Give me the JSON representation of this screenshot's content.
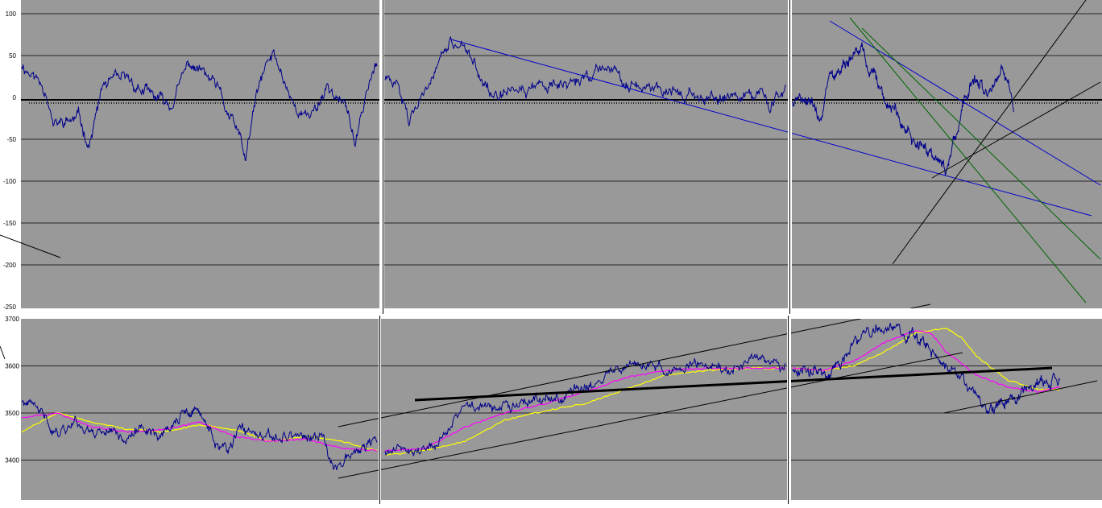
{
  "window": {
    "background": "#ffffff",
    "plot_background": "#999999",
    "divider_color": "#ffffff",
    "series_color": "#00008b",
    "gridline_color": "#000000"
  },
  "chart_data": [
    {
      "id": "oscillator",
      "type": "line",
      "title": "",
      "xlabel": "",
      "ylabel": "",
      "ylim": [
        -250,
        115
      ],
      "yticks": [
        100,
        50,
        0,
        -50,
        -100,
        -150,
        -200,
        -250
      ],
      "grid": true,
      "panels": [
        {
          "id": "osc-left",
          "anchors": [
            [
              0,
              40
            ],
            [
              0.07,
              10
            ],
            [
              0.09,
              -35
            ],
            [
              0.16,
              -25
            ],
            [
              0.19,
              -55
            ],
            [
              0.23,
              15
            ],
            [
              0.3,
              20
            ],
            [
              0.37,
              0
            ],
            [
              0.42,
              -10
            ],
            [
              0.47,
              40
            ],
            [
              0.51,
              30
            ],
            [
              0.55,
              10
            ],
            [
              0.58,
              -20
            ],
            [
              0.61,
              -45
            ],
            [
              0.63,
              -75
            ],
            [
              0.66,
              0
            ],
            [
              0.69,
              40
            ],
            [
              0.71,
              50
            ],
            [
              0.74,
              20
            ],
            [
              0.77,
              -10
            ],
            [
              0.8,
              -25
            ],
            [
              0.83,
              -10
            ],
            [
              0.86,
              15
            ],
            [
              0.89,
              0
            ],
            [
              0.92,
              -20
            ],
            [
              0.94,
              -60
            ],
            [
              0.97,
              10
            ],
            [
              1,
              40
            ]
          ]
        },
        {
          "id": "osc-middle",
          "anchors": [
            [
              0,
              25
            ],
            [
              0.04,
              5
            ],
            [
              0.06,
              -25
            ],
            [
              0.09,
              10
            ],
            [
              0.12,
              20
            ],
            [
              0.15,
              55
            ],
            [
              0.17,
              65
            ],
            [
              0.21,
              50
            ],
            [
              0.25,
              25
            ],
            [
              0.28,
              -5
            ],
            [
              0.31,
              0
            ],
            [
              0.38,
              15
            ],
            [
              0.44,
              10
            ],
            [
              0.48,
              20
            ],
            [
              0.52,
              30
            ],
            [
              0.56,
              40
            ],
            [
              0.6,
              20
            ],
            [
              0.65,
              15
            ],
            [
              0.7,
              10
            ],
            [
              0.76,
              5
            ],
            [
              0.82,
              0
            ],
            [
              0.88,
              5
            ],
            [
              0.94,
              5
            ],
            [
              0.96,
              -10
            ],
            [
              1,
              5
            ]
          ]
        },
        {
          "id": "osc-right",
          "anchors": [
            [
              0,
              -5
            ],
            [
              0.06,
              0
            ],
            [
              0.09,
              -25
            ],
            [
              0.12,
              30
            ],
            [
              0.15,
              40
            ],
            [
              0.19,
              45
            ],
            [
              0.22,
              65
            ],
            [
              0.25,
              40
            ],
            [
              0.29,
              15
            ],
            [
              0.32,
              -10
            ],
            [
              0.36,
              -30
            ],
            [
              0.4,
              -55
            ],
            [
              0.44,
              -60
            ],
            [
              0.47,
              -75
            ],
            [
              0.5,
              -80
            ],
            [
              0.53,
              -50
            ],
            [
              0.56,
              0
            ],
            [
              0.6,
              20
            ],
            [
              0.63,
              0
            ],
            [
              0.66,
              20
            ],
            [
              0.68,
              35
            ],
            [
              0.7,
              20
            ],
            [
              0.72,
              -15
            ]
          ]
        }
      ]
    },
    {
      "id": "price",
      "type": "line",
      "title": "",
      "xlabel": "",
      "ylabel": "",
      "ylim": [
        3310,
        3700
      ],
      "yticks": [
        3700,
        3600,
        3500,
        3400
      ],
      "grid": true,
      "panels": [
        {
          "id": "price-left",
          "price_anchors": [
            [
              0,
              3525
            ],
            [
              0.05,
              3500
            ],
            [
              0.1,
              3460
            ],
            [
              0.15,
              3485
            ],
            [
              0.2,
              3460
            ],
            [
              0.25,
              3470
            ],
            [
              0.3,
              3445
            ],
            [
              0.35,
              3470
            ],
            [
              0.4,
              3455
            ],
            [
              0.45,
              3495
            ],
            [
              0.5,
              3500
            ],
            [
              0.55,
              3435
            ],
            [
              0.58,
              3410
            ],
            [
              0.62,
              3470
            ],
            [
              0.66,
              3445
            ],
            [
              0.7,
              3440
            ],
            [
              0.75,
              3455
            ],
            [
              0.8,
              3450
            ],
            [
              0.85,
              3440
            ],
            [
              0.88,
              3380
            ],
            [
              0.91,
              3415
            ],
            [
              0.95,
              3420
            ],
            [
              1,
              3445
            ]
          ],
          "ma_fast_anchors": [
            [
              0,
              3490
            ],
            [
              0.1,
              3500
            ],
            [
              0.2,
              3470
            ],
            [
              0.3,
              3460
            ],
            [
              0.4,
              3465
            ],
            [
              0.5,
              3480
            ],
            [
              0.6,
              3450
            ],
            [
              0.7,
              3440
            ],
            [
              0.8,
              3445
            ],
            [
              0.9,
              3425
            ],
            [
              1,
              3420
            ]
          ],
          "ma_slow_anchors": [
            [
              0,
              3460
            ],
            [
              0.1,
              3500
            ],
            [
              0.2,
              3480
            ],
            [
              0.3,
              3465
            ],
            [
              0.4,
              3460
            ],
            [
              0.5,
              3475
            ],
            [
              0.6,
              3465
            ],
            [
              0.7,
              3440
            ],
            [
              0.8,
              3450
            ],
            [
              0.9,
              3440
            ],
            [
              1,
              3420
            ]
          ]
        },
        {
          "id": "price-middle",
          "price_anchors": [
            [
              0,
              3420
            ],
            [
              0.04,
              3440
            ],
            [
              0.07,
              3410
            ],
            [
              0.1,
              3430
            ],
            [
              0.14,
              3445
            ],
            [
              0.17,
              3490
            ],
            [
              0.2,
              3510
            ],
            [
              0.24,
              3520
            ],
            [
              0.29,
              3505
            ],
            [
              0.34,
              3520
            ],
            [
              0.38,
              3535
            ],
            [
              0.44,
              3530
            ],
            [
              0.5,
              3560
            ],
            [
              0.56,
              3580
            ],
            [
              0.6,
              3595
            ],
            [
              0.65,
              3600
            ],
            [
              0.7,
              3595
            ],
            [
              0.75,
              3600
            ],
            [
              0.8,
              3600
            ],
            [
              0.86,
              3590
            ],
            [
              0.92,
              3605
            ],
            [
              0.97,
              3590
            ],
            [
              1,
              3595
            ]
          ],
          "ma_fast_anchors": [
            [
              0,
              3420
            ],
            [
              0.1,
              3425
            ],
            [
              0.2,
              3470
            ],
            [
              0.3,
              3500
            ],
            [
              0.4,
              3520
            ],
            [
              0.5,
              3545
            ],
            [
              0.6,
              3575
            ],
            [
              0.7,
              3590
            ],
            [
              0.8,
              3595
            ],
            [
              0.9,
              3595
            ],
            [
              1,
              3595
            ]
          ],
          "ma_slow_anchors": [
            [
              0,
              3410
            ],
            [
              0.1,
              3420
            ],
            [
              0.2,
              3440
            ],
            [
              0.3,
              3485
            ],
            [
              0.4,
              3505
            ],
            [
              0.5,
              3520
            ],
            [
              0.6,
              3550
            ],
            [
              0.7,
              3580
            ],
            [
              0.8,
              3590
            ],
            [
              0.9,
              3595
            ],
            [
              1,
              3595
            ]
          ]
        },
        {
          "id": "price-right",
          "price_anchors": [
            [
              0,
              3595
            ],
            [
              0.08,
              3590
            ],
            [
              0.12,
              3580
            ],
            [
              0.15,
              3610
            ],
            [
              0.2,
              3640
            ],
            [
              0.25,
              3670
            ],
            [
              0.3,
              3690
            ],
            [
              0.35,
              3680
            ],
            [
              0.4,
              3665
            ],
            [
              0.45,
              3640
            ],
            [
              0.5,
              3600
            ],
            [
              0.55,
              3570
            ],
            [
              0.58,
              3540
            ],
            [
              0.62,
              3525
            ],
            [
              0.65,
              3510
            ],
            [
              0.7,
              3525
            ],
            [
              0.75,
              3545
            ],
            [
              0.78,
              3555
            ],
            [
              0.82,
              3560
            ],
            [
              0.85,
              3570
            ],
            [
              0.87,
              3555
            ]
          ],
          "ma_fast_anchors": [
            [
              0,
              3595
            ],
            [
              0.1,
              3590
            ],
            [
              0.2,
              3610
            ],
            [
              0.3,
              3650
            ],
            [
              0.4,
              3675
            ],
            [
              0.45,
              3670
            ],
            [
              0.5,
              3630
            ],
            [
              0.6,
              3580
            ],
            [
              0.7,
              3555
            ],
            [
              0.8,
              3545
            ],
            [
              0.87,
              3555
            ]
          ],
          "ma_slow_anchors": [
            [
              0,
              3595
            ],
            [
              0.1,
              3590
            ],
            [
              0.2,
              3600
            ],
            [
              0.3,
              3630
            ],
            [
              0.4,
              3670
            ],
            [
              0.5,
              3680
            ],
            [
              0.55,
              3660
            ],
            [
              0.6,
              3620
            ],
            [
              0.7,
              3570
            ],
            [
              0.8,
              3550
            ],
            [
              0.87,
              3550
            ]
          ]
        }
      ]
    }
  ]
}
